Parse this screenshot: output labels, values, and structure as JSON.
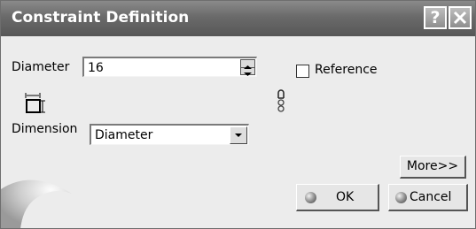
{
  "window": {
    "title": "Constraint Definition",
    "help_label": "?"
  },
  "diameter": {
    "label": "Diameter",
    "value": "16"
  },
  "reference": {
    "label": "Reference",
    "checked": false
  },
  "dimension": {
    "label": "Dimension",
    "selected": "Diameter"
  },
  "buttons": {
    "more": "More>>",
    "ok": "OK",
    "cancel": "Cancel"
  },
  "icons": {
    "dimension_type": "dimension-measure-icon",
    "link": "chain-link-icon",
    "help": "question-mark-icon",
    "close": "close-x-icon",
    "ok": "green-ball-icon",
    "cancel": "red-ball-icon"
  }
}
